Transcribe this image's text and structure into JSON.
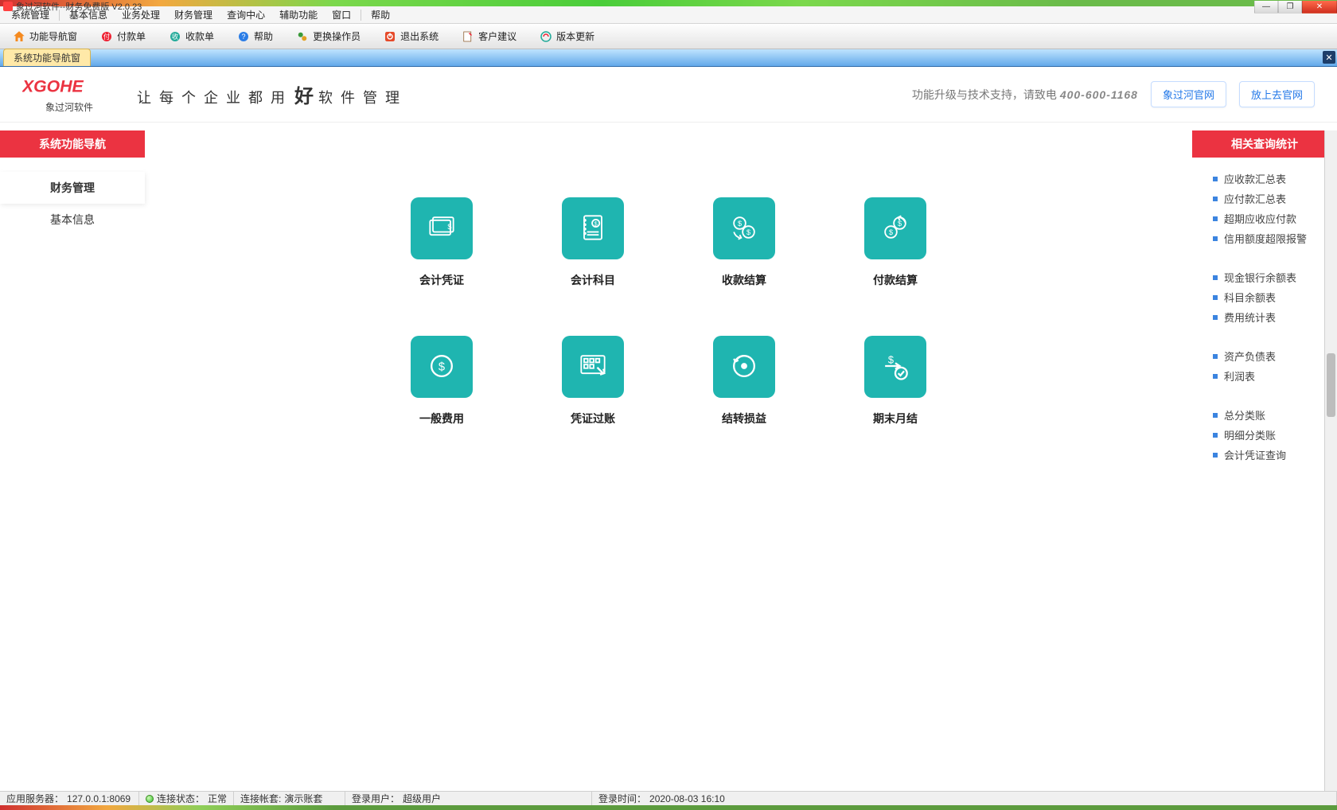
{
  "os_title": "象过河软件--财务免费版 V2.0.23",
  "menu": [
    "系统管理",
    "基本信息",
    "业务处理",
    "财务管理",
    "查询中心",
    "辅助功能",
    "窗口",
    "帮助"
  ],
  "toolbar": [
    {
      "label": "功能导航窗",
      "icon": "house"
    },
    {
      "label": "付款单",
      "icon": "money-out"
    },
    {
      "label": "收款单",
      "icon": "money-in"
    },
    {
      "label": "帮助",
      "icon": "help"
    },
    {
      "label": "更换操作员",
      "icon": "switch-user"
    },
    {
      "label": "退出系统",
      "icon": "exit"
    },
    {
      "label": "客户建议",
      "icon": "note"
    },
    {
      "label": "版本更新",
      "icon": "update"
    }
  ],
  "tab_active": "系统功能导航窗",
  "brand": {
    "logo_text": "XGOHE",
    "logo_sub": "象过河软件",
    "slogan_chars": [
      "让",
      "每",
      "个",
      "企",
      "业",
      "都",
      "用"
    ],
    "slogan_big": "好",
    "slogan_tail": [
      "软",
      "件",
      "管",
      "理"
    ],
    "support_prefix": "功能升级与技术支持，请致电",
    "phone": "400-600-1168",
    "btn1": "象过河官网",
    "btn2": "放上去官网"
  },
  "left": {
    "header": "系统功能导航",
    "items": [
      {
        "label": "财务管理",
        "active": true
      },
      {
        "label": "基本信息",
        "active": false
      }
    ]
  },
  "cards": [
    {
      "label": "会计凭证",
      "icon": "voucher"
    },
    {
      "label": "会计科目",
      "icon": "subject"
    },
    {
      "label": "收款结算",
      "icon": "receive"
    },
    {
      "label": "付款结算",
      "icon": "pay"
    },
    {
      "label": "一般费用",
      "icon": "expense"
    },
    {
      "label": "凭证过账",
      "icon": "post"
    },
    {
      "label": "结转损益",
      "icon": "carry"
    },
    {
      "label": "期末月结",
      "icon": "monthend"
    }
  ],
  "right": {
    "header": "相关查询统计",
    "groups": [
      [
        "应收款汇总表",
        "应付款汇总表",
        "超期应收应付款",
        "信用额度超限报警"
      ],
      [
        "现金银行余额表",
        "科目余额表",
        "费用统计表"
      ],
      [
        "资产负债表",
        "利润表"
      ],
      [
        "总分类账",
        "明细分类账",
        "会计凭证查询"
      ]
    ]
  },
  "status": {
    "server_label": "应用服务器：",
    "server_value": "127.0.0.1:8069",
    "conn_label": "连接状态：",
    "conn_value": "正常",
    "acct_label": "连接帐套:",
    "acct_value": "演示账套",
    "user_label": "登录用户：",
    "user_value": "超级用户",
    "login_label": "登录时间：",
    "login_value": "2020-08-03 16:10"
  }
}
